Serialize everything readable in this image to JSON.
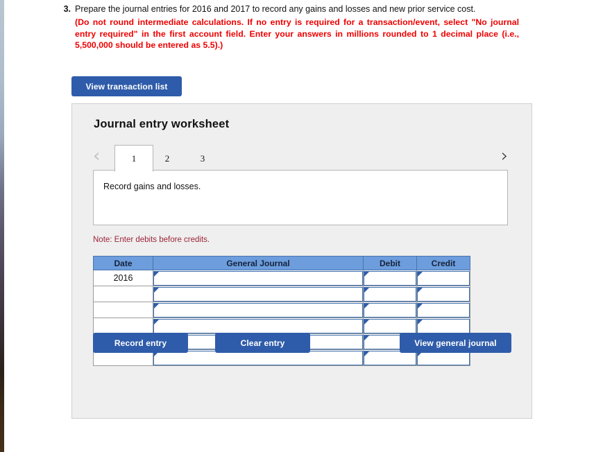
{
  "question": {
    "number": "3.",
    "lead": "Prepare the journal entries for 2016 and 2017 to record any gains and losses and new prior service cost.",
    "instructions": "(Do not round intermediate calculations. If no entry is required for a transaction/event, select \"No journal entry required\" in the first account field. Enter your answers in millions rounded to 1 decimal place (i.e., 5,500,000 should be entered as 5.5).)",
    "instruction_color": "#ee0000"
  },
  "toolbar": {
    "view_transaction_list_label": "View transaction list"
  },
  "worksheet": {
    "title": "Journal entry worksheet",
    "tabs": [
      {
        "label": "1",
        "active": true
      },
      {
        "label": "2",
        "active": false
      },
      {
        "label": "3",
        "active": false
      }
    ],
    "prev_icon": "chevron-left-icon",
    "next_icon": "chevron-right-icon",
    "prev_glyph": "‹",
    "next_glyph": "›",
    "description": "Record gains and losses.",
    "note": "Note: Enter debits before credits.",
    "note_color": "#9c2437",
    "table": {
      "headers": [
        "Date",
        "General Journal",
        "Debit",
        "Credit"
      ],
      "header_bg": "#6d9ddd",
      "rows": [
        {
          "date": "2016",
          "general_journal": "",
          "debit": "",
          "credit": ""
        },
        {
          "date": "",
          "general_journal": "",
          "debit": "",
          "credit": ""
        },
        {
          "date": "",
          "general_journal": "",
          "debit": "",
          "credit": ""
        },
        {
          "date": "",
          "general_journal": "",
          "debit": "",
          "credit": ""
        },
        {
          "date": "",
          "general_journal": "",
          "debit": "",
          "credit": ""
        },
        {
          "date": "",
          "general_journal": "",
          "debit": "",
          "credit": ""
        }
      ]
    },
    "buttons": {
      "record_entry": "Record entry",
      "clear_entry": "Clear entry",
      "view_general_journal": "View general journal",
      "color": "#2f5caa"
    }
  }
}
